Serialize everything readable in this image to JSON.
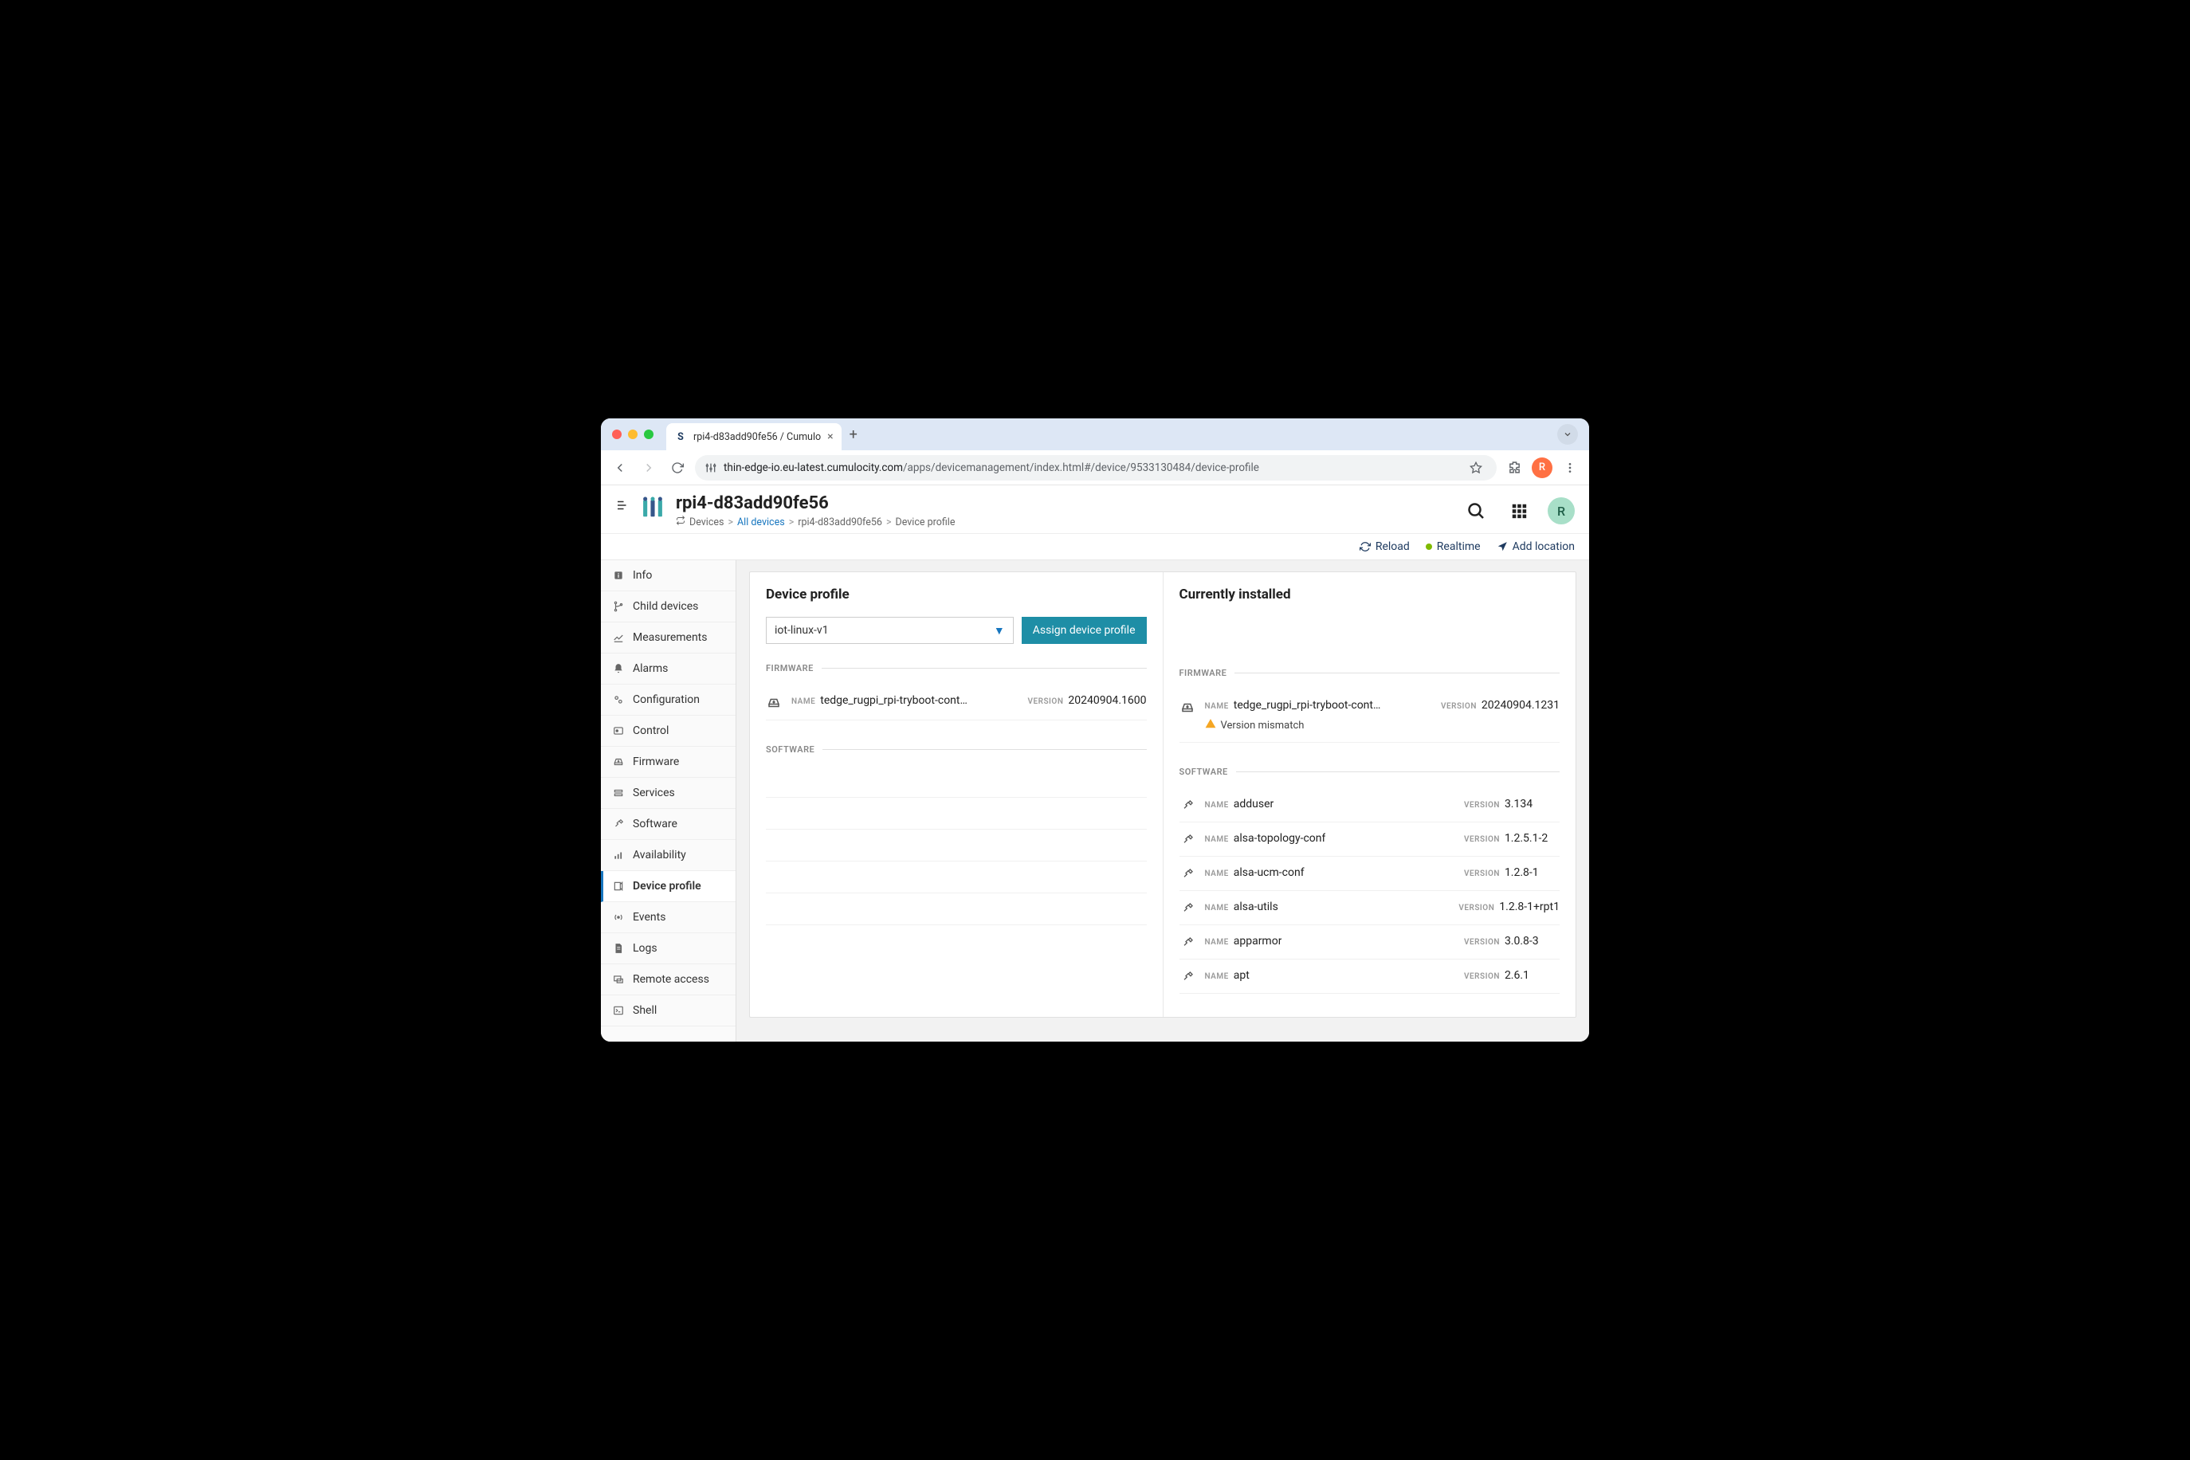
{
  "browser": {
    "tab_title": "rpi4-d83add90fe56 / Cumulo",
    "url_domain": "thin-edge-io.eu-latest.cumulocity.com",
    "url_path": "/apps/devicemanagement/index.html#/device/9533130484/device-profile",
    "avatar_letter": "R"
  },
  "header": {
    "title": "rpi4-d83add90fe56",
    "breadcrumb": {
      "devices": "Devices",
      "all_devices": "All devices",
      "device": "rpi4-d83add90fe56",
      "page": "Device profile"
    },
    "avatar_letter": "R"
  },
  "toolbar": {
    "reload": "Reload",
    "realtime": "Realtime",
    "add_location": "Add location"
  },
  "sidebar": {
    "items": [
      {
        "label": "Info"
      },
      {
        "label": "Child devices"
      },
      {
        "label": "Measurements"
      },
      {
        "label": "Alarms"
      },
      {
        "label": "Configuration"
      },
      {
        "label": "Control"
      },
      {
        "label": "Firmware"
      },
      {
        "label": "Services"
      },
      {
        "label": "Software"
      },
      {
        "label": "Availability"
      },
      {
        "label": "Device profile"
      },
      {
        "label": "Events"
      },
      {
        "label": "Logs"
      },
      {
        "label": "Remote access"
      },
      {
        "label": "Shell"
      }
    ]
  },
  "profile": {
    "title": "Device profile",
    "select_value": "iot-linux-v1",
    "assign_button": "Assign device profile",
    "firmware_label": "FIRMWARE",
    "software_label": "SOFTWARE",
    "name_label": "NAME",
    "version_label": "VERSION",
    "firmware": {
      "name": "tedge_rugpi_rpi-tryboot-contai...",
      "version": "20240904.1600"
    }
  },
  "installed": {
    "title": "Currently installed",
    "firmware_label": "FIRMWARE",
    "software_label": "SOFTWARE",
    "name_label": "NAME",
    "version_label": "VERSION",
    "firmware": {
      "name": "tedge_rugpi_rpi-tryboot-contai...",
      "version": "20240904.1231",
      "warning": "Version mismatch"
    },
    "software": [
      {
        "name": "adduser",
        "version": "3.134"
      },
      {
        "name": "alsa-topology-conf",
        "version": "1.2.5.1-2"
      },
      {
        "name": "alsa-ucm-conf",
        "version": "1.2.8-1"
      },
      {
        "name": "alsa-utils",
        "version": "1.2.8-1+rpt1"
      },
      {
        "name": "apparmor",
        "version": "3.0.8-3"
      },
      {
        "name": "apt",
        "version": "2.6.1"
      }
    ]
  }
}
